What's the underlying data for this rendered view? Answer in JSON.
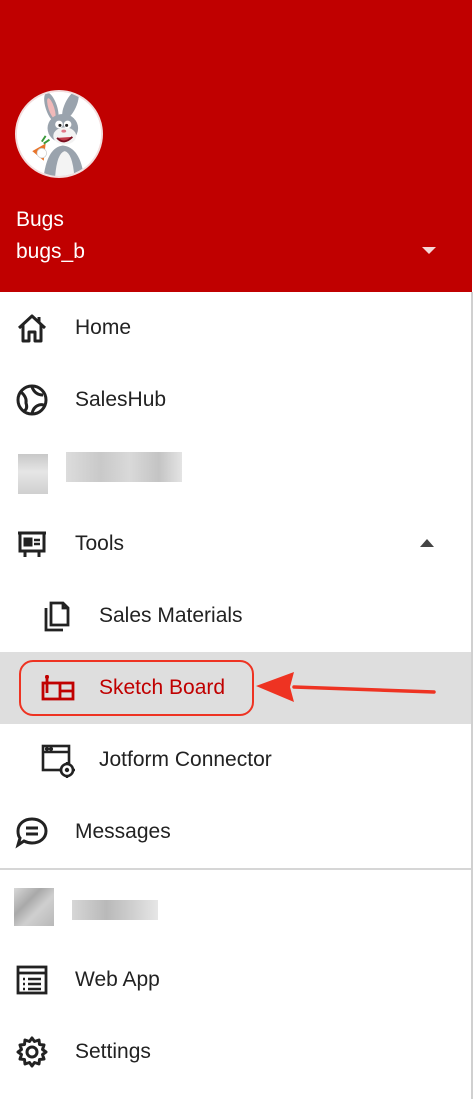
{
  "user": {
    "name": "Bugs",
    "handle": "bugs_b",
    "avatar_icon": "bugs-bunny-avatar"
  },
  "colors": {
    "brand": "#c00000",
    "active_bg": "#dedede",
    "annotation": "#ee3322"
  },
  "menu": {
    "home": "Home",
    "saleshub": "SalesHub",
    "tools": "Tools",
    "sales_materials": "Sales Materials",
    "sketch_board": "Sketch Board",
    "jotform_connector": "Jotform Connector",
    "messages": "Messages",
    "web_app": "Web App",
    "settings": "Settings"
  },
  "icons": {
    "home": "home-icon",
    "saleshub": "globe-icon",
    "tools": "presentation-icon",
    "sales_materials": "copy-icon",
    "sketch_board": "sketch-board-icon",
    "jotform_connector": "form-settings-icon",
    "messages": "message-icon",
    "web_app": "browser-list-icon",
    "settings": "gear-icon"
  }
}
